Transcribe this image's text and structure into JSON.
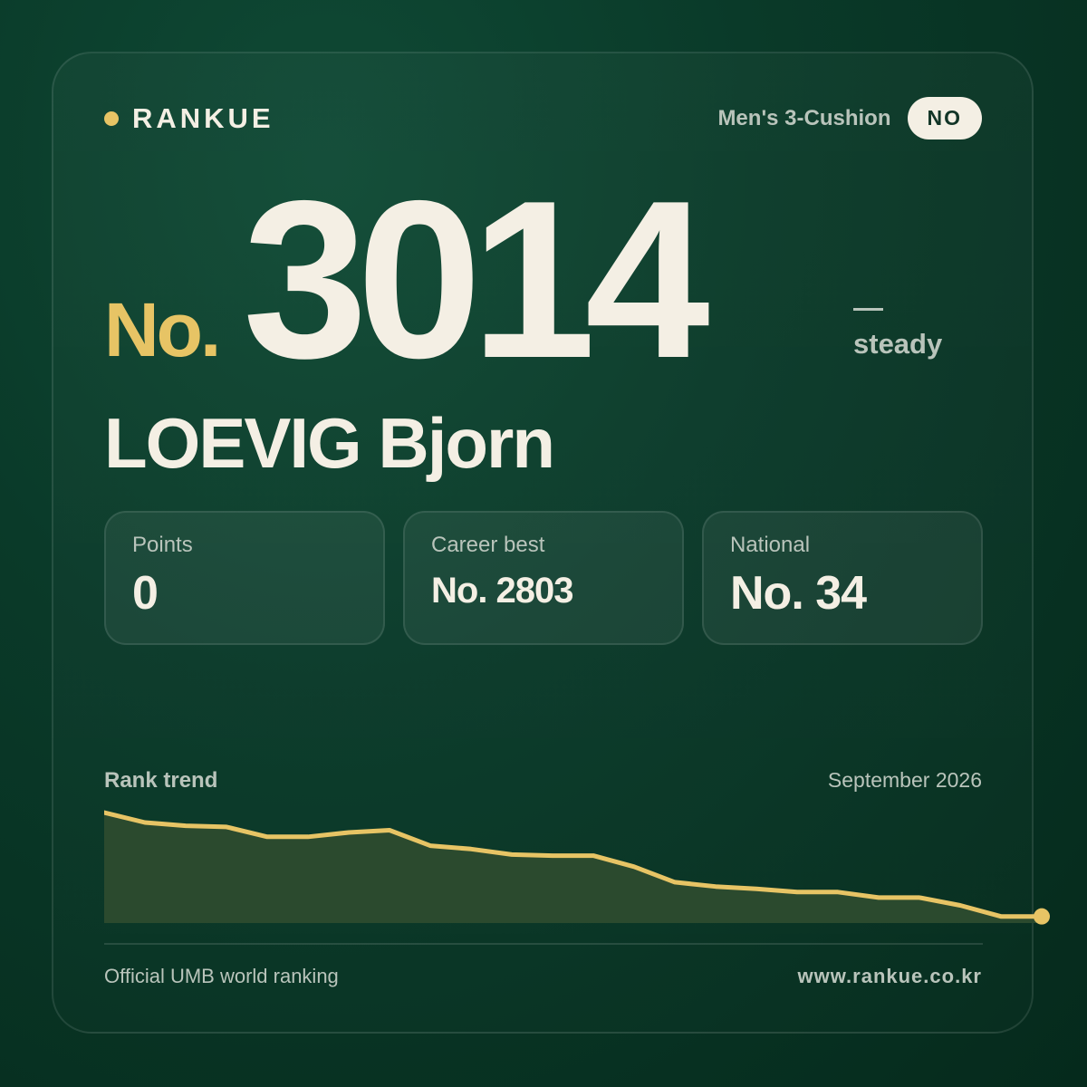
{
  "brand": {
    "name": "RANKUE",
    "accent_color": "#e7c465"
  },
  "header": {
    "category": "Men's 3-Cushion",
    "country_code": "NO"
  },
  "rank": {
    "prefix": "No.",
    "value": "3014",
    "trend_symbol": "—",
    "trend_label": "steady"
  },
  "player": {
    "name": "LOEVIG Bjorn"
  },
  "stats": [
    {
      "label": "Points",
      "value": "0"
    },
    {
      "label": "Career best",
      "value": "No. 2803"
    },
    {
      "label": "National",
      "value": "No. 34"
    }
  ],
  "trend": {
    "title": "Rank trend",
    "date": "September 2026"
  },
  "chart_data": {
    "type": "area",
    "title": "Rank trend",
    "y_meaning": "relative rank position, higher = better",
    "values": [
      100,
      91,
      88,
      87,
      78,
      78,
      82,
      84,
      70,
      67,
      62,
      61,
      61,
      51,
      37,
      33,
      31,
      28,
      28,
      23,
      23,
      16,
      6,
      6
    ],
    "ylim": [
      0,
      100
    ],
    "line_color": "#e7c465",
    "fill_color": "#2b4a2e",
    "endpoint_marker": true
  },
  "footer": {
    "source": "Official UMB world ranking",
    "url": "www.rankue.co.kr"
  }
}
